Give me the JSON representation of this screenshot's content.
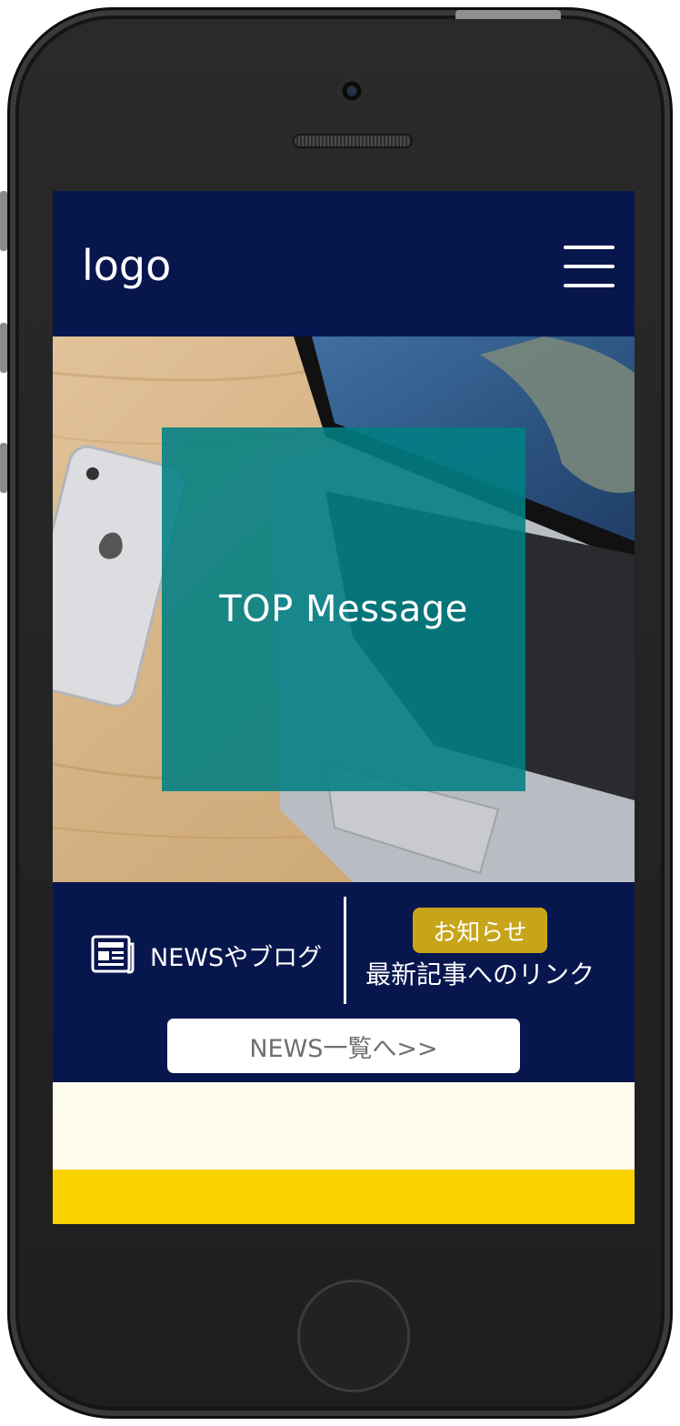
{
  "header": {
    "logo": "logo",
    "menu_icon": "hamburger-menu-icon"
  },
  "hero": {
    "message": "TOP Message"
  },
  "news": {
    "icon": "newspaper-icon",
    "left_label": "NEWSやブログ",
    "badge": "お知らせ",
    "right_label": "最新記事へのリンク",
    "list_button": "NEWS一覧へ>>"
  },
  "colors": {
    "header_bg": "#08164e",
    "hero_overlay": "#008084",
    "badge_bg": "#c7a51a",
    "cream": "#fcfbee",
    "yellow": "#fad200"
  }
}
